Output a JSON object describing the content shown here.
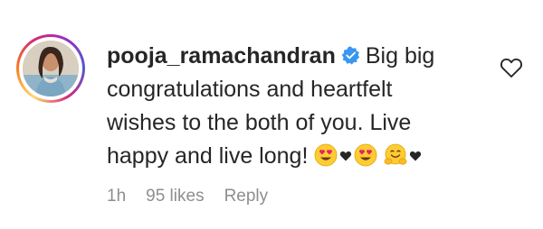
{
  "comment": {
    "username": "pooja_ramachandran",
    "verified": true,
    "text_line1": "Big big",
    "text_line2": "congratulations and heartfelt",
    "text_line3": "wishes to the both of you. Live",
    "text_line4": "happy and live long!",
    "emojis": [
      "heart-eyes",
      "black-heart",
      "heart-eyes",
      "hugging-face",
      "black-heart"
    ]
  },
  "meta": {
    "time": "1h",
    "likes": "95 likes",
    "reply": "Reply"
  },
  "colors": {
    "text": "#262626",
    "muted": "#8e8e8e",
    "verified_blue": "#3897f0",
    "emoji_yellow": "#ffcc33",
    "heart_red": "#e0245e"
  },
  "icons": {
    "verified": "verified-badge-icon",
    "like": "heart-outline-icon"
  }
}
